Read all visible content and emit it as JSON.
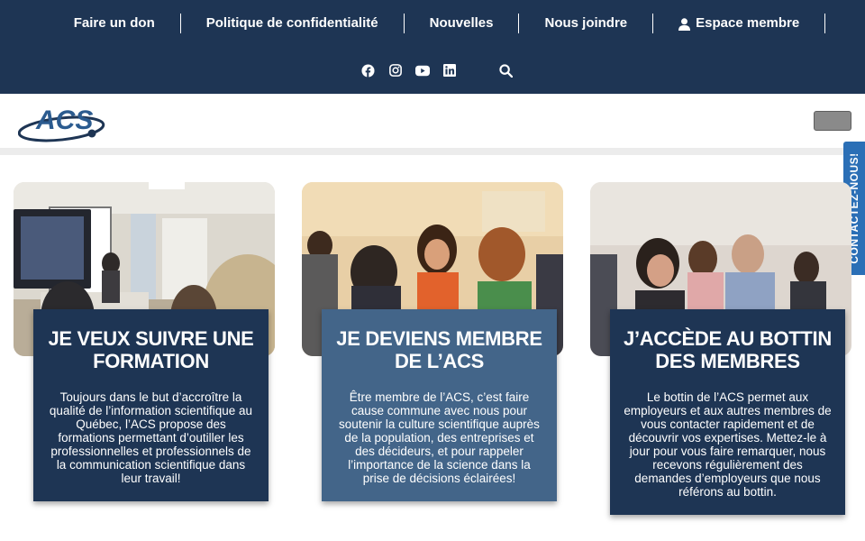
{
  "topnav": {
    "items": [
      {
        "label": "Faire un don"
      },
      {
        "label": "Politique de confidentialité"
      },
      {
        "label": "Nouvelles"
      },
      {
        "label": "Nous joindre"
      },
      {
        "label": "Espace membre"
      }
    ]
  },
  "social": {
    "icons": [
      "facebook-icon",
      "instagram-icon",
      "youtube-icon",
      "linkedin-icon",
      "search-icon"
    ]
  },
  "header": {
    "logo_text": "ACS"
  },
  "contact_tab": {
    "label": "CONTACTEZ-NOUS!"
  },
  "cards": [
    {
      "title": "JE VEUX SUIVRE UNE FORMATION",
      "text": "Toujours dans le but d’accroître la qualité de l’information scientifique au Québec, l’ACS propose des formations permettant d’outiller les professionnelles et professionnels de la communication scientifique dans leur travail!"
    },
    {
      "title": "JE DEVIENS MEMBRE DE L’ACS",
      "text": "Être membre de l’ACS, c’est faire cause commune avec nous pour soutenir la culture scientifique auprès de la population, des entreprises et des décideurs, et pour rappeler l’importance de la science dans la prise de décisions éclairées!"
    },
    {
      "title": "J’ACCÈDE AU BOTTIN DES MEMBRES",
      "text": "Le bottin de l’ACS permet aux employeurs et aux autres membres de vous contacter rapidement et de découvrir vos expertises. Mettez-le à jour pour vous faire remarquer, nous recevons régulièrement des demandes d’employeurs que nous référons au bottin."
    }
  ],
  "colors": {
    "navy": "#1e3554",
    "card_highlight": "#436589",
    "contact_blue": "#2b6fb6"
  }
}
